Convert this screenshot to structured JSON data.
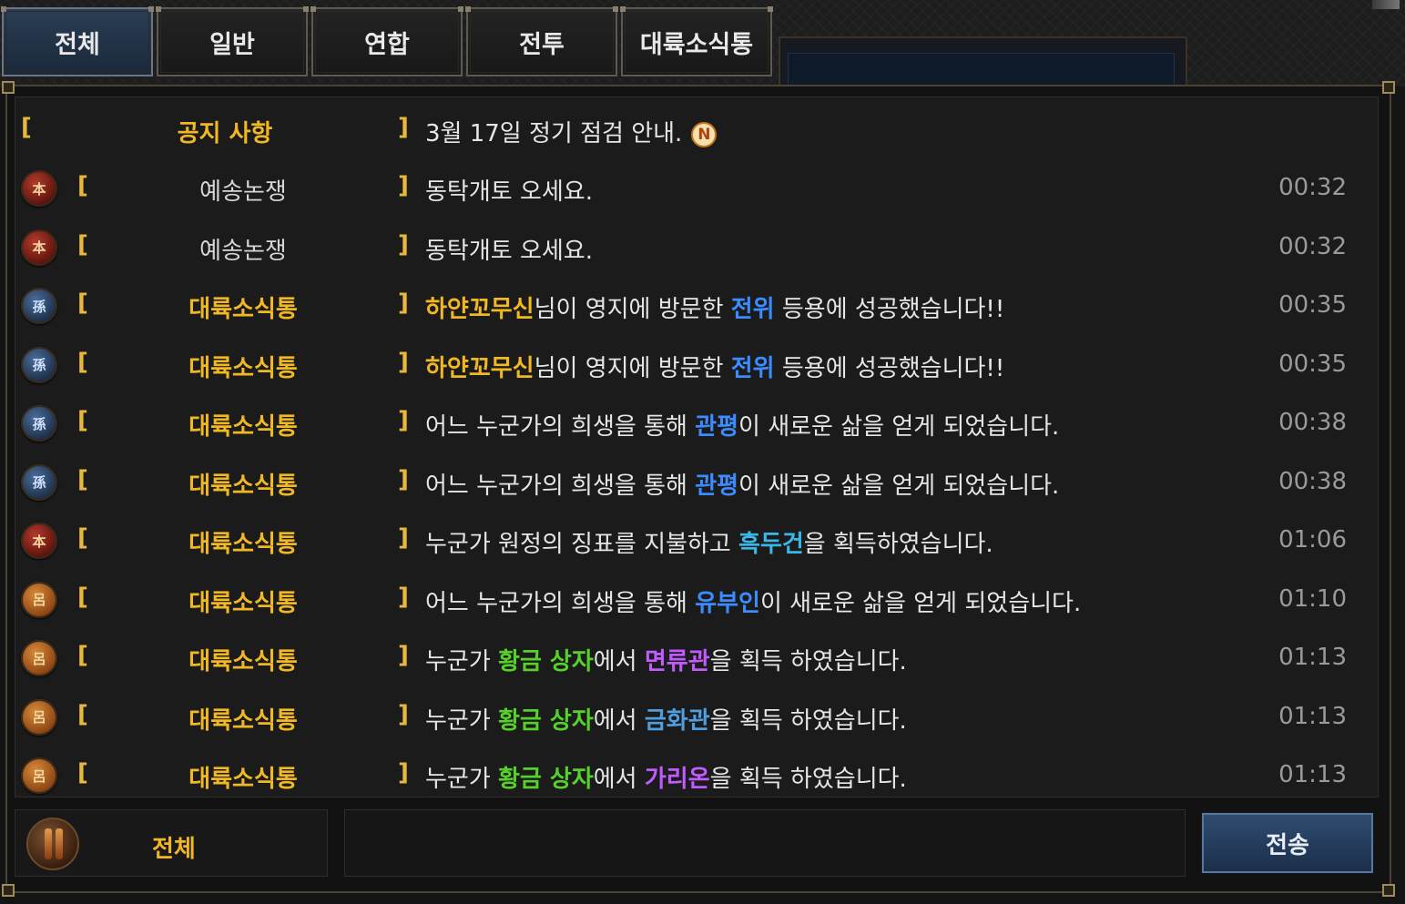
{
  "tabs": [
    {
      "label": "전체",
      "active": true
    },
    {
      "label": "일반",
      "active": false
    },
    {
      "label": "연합",
      "active": false
    },
    {
      "label": "전투",
      "active": false
    },
    {
      "label": "대륙소식통",
      "active": false
    }
  ],
  "notice": {
    "channel": "공지 사항",
    "message": "3월 17일 정기 점검 안내.",
    "badge": "N"
  },
  "messages": [
    {
      "icon": "red-faction-emblem",
      "channel": "예송논쟁",
      "parts": [
        {
          "t": "동탁개토 오세요.",
          "c": ""
        }
      ],
      "time": "00:32"
    },
    {
      "icon": "red-faction-emblem",
      "channel": "예송논쟁",
      "parts": [
        {
          "t": "동탁개토 오세요.",
          "c": ""
        }
      ],
      "time": "00:32"
    },
    {
      "icon": "blue-faction-emblem",
      "channel": "대륙소식통",
      "parts": [
        {
          "t": "하얀꼬무신",
          "c": "yellow"
        },
        {
          "t": "님이 영지에 방문한 ",
          "c": ""
        },
        {
          "t": "전위",
          "c": "blue"
        },
        {
          "t": " 등용에 성공했습니다!!",
          "c": ""
        }
      ],
      "time": "00:35"
    },
    {
      "icon": "blue-faction-emblem",
      "channel": "대륙소식통",
      "parts": [
        {
          "t": "하얀꼬무신",
          "c": "yellow"
        },
        {
          "t": "님이 영지에 방문한 ",
          "c": ""
        },
        {
          "t": "전위",
          "c": "blue"
        },
        {
          "t": " 등용에 성공했습니다!!",
          "c": ""
        }
      ],
      "time": "00:35"
    },
    {
      "icon": "blue-faction-emblem",
      "channel": "대륙소식통",
      "parts": [
        {
          "t": "어느 누군가의 희생을 통해 ",
          "c": ""
        },
        {
          "t": "관평",
          "c": "blue"
        },
        {
          "t": "이 새로운 삶을 얻게 되었습니다.",
          "c": ""
        }
      ],
      "time": "00:38"
    },
    {
      "icon": "blue-faction-emblem",
      "channel": "대륙소식통",
      "parts": [
        {
          "t": "어느 누군가의 희생을 통해 ",
          "c": ""
        },
        {
          "t": "관평",
          "c": "blue"
        },
        {
          "t": "이 새로운 삶을 얻게 되었습니다.",
          "c": ""
        }
      ],
      "time": "00:38"
    },
    {
      "icon": "red-faction-emblem",
      "channel": "대륙소식통",
      "parts": [
        {
          "t": "누군가 원정의 징표를 지불하고 ",
          "c": ""
        },
        {
          "t": "흑두건",
          "c": "cyan"
        },
        {
          "t": "을 획득하였습니다.",
          "c": ""
        }
      ],
      "time": "01:06"
    },
    {
      "icon": "orange-faction-emblem",
      "channel": "대륙소식통",
      "parts": [
        {
          "t": "어느 누군가의 희생을 통해 ",
          "c": ""
        },
        {
          "t": "유부인",
          "c": "blue"
        },
        {
          "t": "이 새로운 삶을 얻게 되었습니다.",
          "c": ""
        }
      ],
      "time": "01:10"
    },
    {
      "icon": "orange-faction-emblem",
      "channel": "대륙소식통",
      "parts": [
        {
          "t": "누군가 ",
          "c": ""
        },
        {
          "t": "황금 상자",
          "c": "green"
        },
        {
          "t": "에서 ",
          "c": ""
        },
        {
          "t": "면류관",
          "c": "purple"
        },
        {
          "t": "을 획득 하였습니다.",
          "c": ""
        }
      ],
      "time": "01:13"
    },
    {
      "icon": "orange-faction-emblem",
      "channel": "대륙소식통",
      "parts": [
        {
          "t": "누군가 ",
          "c": ""
        },
        {
          "t": "황금 상자",
          "c": "green"
        },
        {
          "t": "에서 ",
          "c": ""
        },
        {
          "t": "금화관",
          "c": "steel"
        },
        {
          "t": "을 획득 하였습니다.",
          "c": ""
        }
      ],
      "time": "01:13"
    },
    {
      "icon": "orange-faction-emblem",
      "channel": "대륙소식통",
      "parts": [
        {
          "t": "누군가 ",
          "c": ""
        },
        {
          "t": "황금 상자",
          "c": "green"
        },
        {
          "t": "에서 ",
          "c": ""
        },
        {
          "t": "가리온",
          "c": "purple"
        },
        {
          "t": "을 획득 하였습니다.",
          "c": ""
        }
      ],
      "time": "01:13"
    }
  ],
  "input_bar": {
    "channel_label": "전체",
    "channel_icon": "scroll-icon",
    "input_value": "",
    "send_label": "전송"
  },
  "colors": {
    "channel_gold": "#f1b823",
    "name_blue": "#3a8cff",
    "item_green": "#55d12a",
    "item_purple": "#c25bff",
    "item_cyan": "#3ab7e8",
    "timestamp_gray": "#9a9a9a",
    "tab_active_blue": "#2b3e55"
  }
}
